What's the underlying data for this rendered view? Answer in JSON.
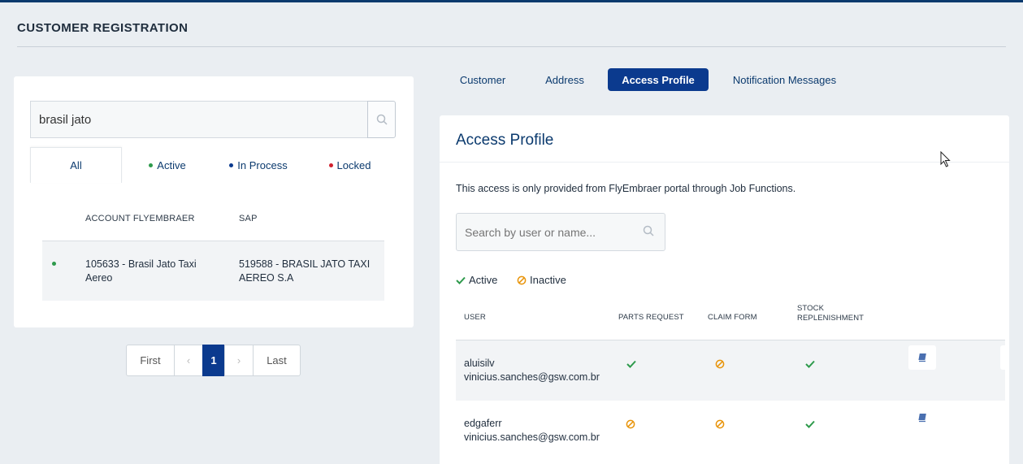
{
  "page": {
    "title": "CUSTOMER REGISTRATION"
  },
  "search": {
    "value": "brasil jato",
    "icon": "search-icon"
  },
  "filters": [
    {
      "label": "All"
    },
    {
      "label": "Active",
      "color": "#2e9a4c"
    },
    {
      "label": "In Process",
      "color": "#0b3a8e"
    },
    {
      "label": "Locked",
      "color": "#d0202e"
    }
  ],
  "accounts": {
    "headers": {
      "account": "ACCOUNT FLYEMBRAER",
      "sap": "SAP"
    },
    "rows": [
      {
        "status": "Active",
        "account": "105633 - Brasil Jato Taxi Aereo",
        "sap": "519588 - BRASIL JATO TAXI AEREO S.A"
      }
    ]
  },
  "pagination": {
    "first": "First",
    "prev": "‹",
    "current": "1",
    "next": "›",
    "last": "Last"
  },
  "tabs": [
    {
      "label": "Customer"
    },
    {
      "label": "Address"
    },
    {
      "label": "Access Profile",
      "active": true
    },
    {
      "label": "Notification Messages"
    }
  ],
  "access_profile": {
    "title": "Access Profile",
    "info": "This access is only provided from FlyEmbraer portal through Job Functions.",
    "search_placeholder": "Search by user or name...",
    "legend": {
      "active": "Active",
      "inactive": "Inactive"
    },
    "headers": {
      "user": "USER",
      "parts": "PARTS REQUEST",
      "claim": "CLAIM FORM",
      "stock_1": "STOCK",
      "stock_2": "REPLENISHMENT"
    },
    "rows": [
      {
        "user": "aluisilv",
        "email": "vinicius.sanches@gsw.com.br",
        "parts": "active",
        "claim": "inactive",
        "stock": "active"
      },
      {
        "user": "edgaferr",
        "email": "vinicius.sanches@gsw.com.br",
        "parts": "inactive",
        "claim": "inactive",
        "stock": "active"
      }
    ]
  },
  "colors": {
    "brand": "#0b3a8e",
    "active": "#2e9a4c",
    "inactive": "#e8940a",
    "locked": "#d0202e"
  }
}
